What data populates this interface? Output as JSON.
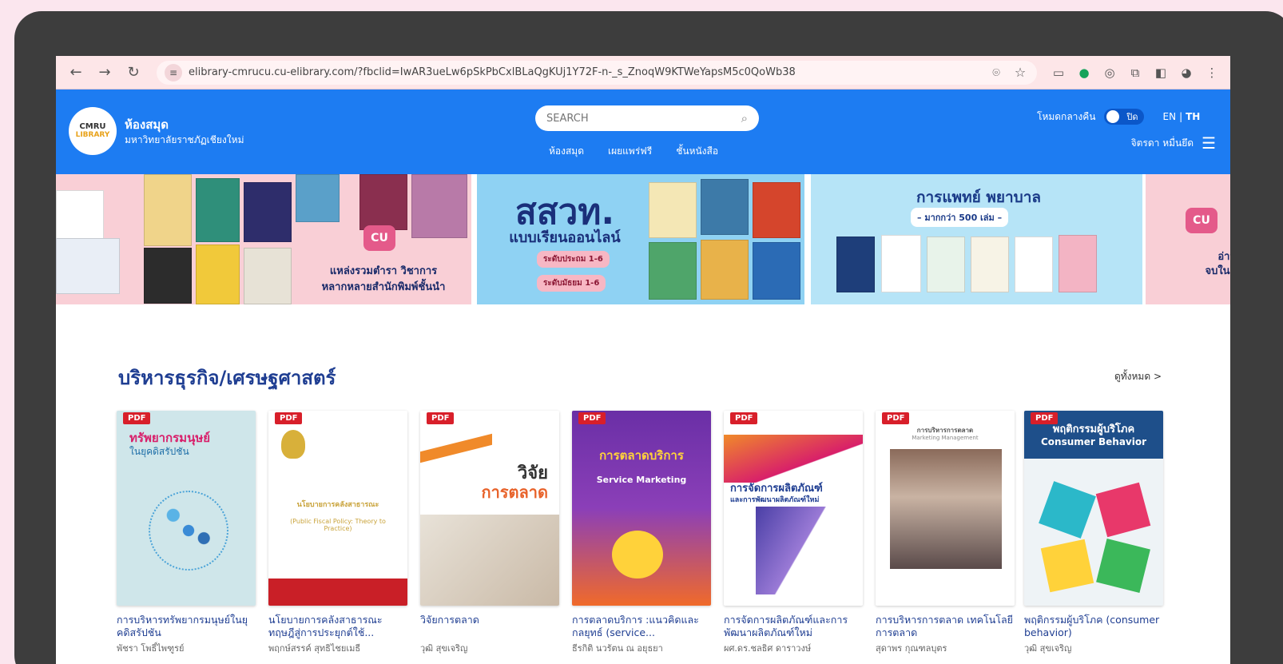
{
  "browser": {
    "url": "elibrary-cmrucu.cu-elibrary.com/?fbclid=IwAR3ueLw6pSkPbCxlBLaQgKUj1Y72F-n-_s_ZnoqW9KTWeYapsM5c0QoWb38"
  },
  "header": {
    "logo_text": "CMRU",
    "logo_sub": "LIBRARY",
    "brand_title": "ห้องสมุด",
    "brand_sub": "มหาวิทยาลัยราชภัฏเชียงใหม่",
    "search_placeholder": "SEARCH",
    "nav": [
      "ห้องสมุด",
      "เผยแพร่ฟรี",
      "ชั้นหนังสือ"
    ],
    "night_mode_label": "โหมดกลางคืน",
    "night_toggle_state": "ปิด",
    "lang_en": "EN",
    "lang_sep": "|",
    "lang_th": "TH",
    "user_name": "จิตรดา หมื่นยึด"
  },
  "banners": {
    "b1_line1": "แหล่งรวมตำรา วิชาการ",
    "b1_line2": "หลากหลายสำนักพิมพ์ชั้นนำ",
    "b2_title": "สสวท.",
    "b2_sub": "แบบเรียนออนไลน์",
    "b2_pill1": "ระดับประถม 1-6",
    "b2_pill2": "ระดับมัธยม 1-6",
    "b3_title": "การแพทย์ พยาบาล",
    "b3_sub": "– มากกว่า 500 เล่ม –",
    "b4_line1": "อ่านคร",
    "b4_line2": "จบในแอป"
  },
  "section": {
    "title": "บริหารธุรกิจ/เศรษฐศาสตร์",
    "see_all": "ดูทั้งหมด >",
    "badge": "PDF",
    "books": [
      {
        "title": "การบริหารทรัพยากรมนุษย์ในยุคดิสรัปชัน",
        "author": "พัชรา โพธิ์ไพฑูรย์",
        "cover_text": "ทรัพยากรมนุษย์",
        "cover_sub": "ในยุคดิสรัปชัน"
      },
      {
        "title": "นโยบายการคลังสาธารณะ ทฤษฎีสู่การประยุกต์ใช้...",
        "author": "พฤกษ์สรรค์ สุทธิไชยเมธี",
        "cover_text": "นโยบายการคลังสาธารณะ",
        "cover_sub": "(Public Fiscal Policy: Theory to Practice)"
      },
      {
        "title": "วิจัยการตลาด",
        "author": "วุฒิ สุขเจริญ",
        "cover_text": "วิจัย",
        "cover_sub": "การตลาด"
      },
      {
        "title": "การตลาดบริการ :แนวคิดและกลยุทธ์ (service...",
        "author": "ธีรกิติ นวรัตน ณ อยุธยา",
        "cover_text": "การตลาดบริการ",
        "cover_sub": "Service Marketing"
      },
      {
        "title": "การจัดการผลิตภัณฑ์และการพัฒนาผลิตภัณฑ์ใหม่",
        "author": "ผศ.ดร.ชลธิศ ดาราวงษ์",
        "cover_text": "การจัดการผลิตภัณฑ์",
        "cover_sub": "และการพัฒนาผลิตภัณฑ์ใหม่"
      },
      {
        "title": "การบริหารการตลาด เทคโนโลยีการตลาด",
        "author": "สุดาพร กุณฑลบุตร",
        "cover_text": "การบริหารการตลาด",
        "cover_sub": "Marketing Management"
      },
      {
        "title": "พฤติกรรมผู้บริโภค (consumer behavior)",
        "author": "วุฒิ สุขเจริญ",
        "cover_text": "พฤติกรรมผู้บริโภค",
        "cover_sub": "Consumer Behavior"
      }
    ]
  },
  "colors": {
    "header_blue": "#1d7cf2",
    "title_navy": "#1f3e92",
    "pdf_red": "#d81f2a",
    "background_pink": "#fbe6ee",
    "frame": "#3d3d3d"
  }
}
